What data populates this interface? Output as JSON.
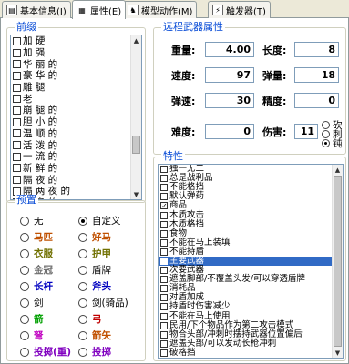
{
  "tabs": [
    {
      "label": "基本信息(I)",
      "icon": "info-icon"
    },
    {
      "label": "属性(E)",
      "icon": "props-icon"
    },
    {
      "label": "模型动作(M)",
      "icon": "model-icon"
    },
    {
      "label": "触发器(T)",
      "icon": "trigger-icon"
    }
  ],
  "prefix": {
    "title": "前缀",
    "items": [
      {
        "label": "加 硬",
        "checked": false
      },
      {
        "label": "加 强",
        "checked": false
      },
      {
        "label": "华 丽 的",
        "checked": false
      },
      {
        "label": "豪 华 的",
        "checked": false
      },
      {
        "label": "雕 腿",
        "checked": false
      },
      {
        "label": "老",
        "checked": false
      },
      {
        "label": "崩 腿 的",
        "checked": false
      },
      {
        "label": "胆 小 的",
        "checked": false
      },
      {
        "label": "温 顺 的",
        "checked": false
      },
      {
        "label": "活 泼 的",
        "checked": false
      },
      {
        "label": "一 流 的",
        "checked": false
      },
      {
        "label": "新 鲜 的",
        "checked": false
      },
      {
        "label": "隔 夜 的",
        "checked": false
      },
      {
        "label": "隔 两 夜 的",
        "checked": false
      },
      {
        "label": "发 臭 的",
        "checked": false
      },
      {
        "label": "腐 烂 的",
        "checked": false
      },
      {
        "label": "一 大 袋",
        "checked": true,
        "selected": true
      }
    ]
  },
  "presets": {
    "title": "预置",
    "items": [
      {
        "label": "无",
        "color": "#000000",
        "checked": false
      },
      {
        "label": "自定义",
        "color": "#000000",
        "checked": true
      },
      {
        "label": "马匹",
        "color": "#c05000",
        "checked": false
      },
      {
        "label": "好马",
        "color": "#c05000",
        "checked": false
      },
      {
        "label": "衣服",
        "color": "#707000",
        "checked": false
      },
      {
        "label": "护甲",
        "color": "#707000",
        "checked": false
      },
      {
        "label": "金冠",
        "color": "#707070",
        "checked": false
      },
      {
        "label": "盾牌",
        "color": "#000000",
        "checked": false
      },
      {
        "label": "长杆",
        "color": "#0000c0",
        "checked": false
      },
      {
        "label": "斧头",
        "color": "#0000c0",
        "checked": false
      },
      {
        "label": "剑",
        "color": "#000000",
        "checked": false
      },
      {
        "label": "剑(骑品)",
        "color": "#000000",
        "checked": false
      },
      {
        "label": "箭",
        "color": "#00a000",
        "checked": false
      },
      {
        "label": "弓",
        "color": "#c00000",
        "checked": false
      },
      {
        "label": "弩",
        "color": "#c000c0",
        "checked": false
      },
      {
        "label": "箭矢",
        "color": "#c05000",
        "checked": false
      },
      {
        "label": "投掷(重)",
        "color": "#8000c0",
        "checked": false
      },
      {
        "label": "投掷",
        "color": "#8000c0",
        "checked": false
      }
    ]
  },
  "weapon": {
    "title": "远程武器属性",
    "weight_label": "重量:",
    "weight": "4.00",
    "length_label": "长度:",
    "length": "8",
    "speed_label": "速度:",
    "speed": "97",
    "ammo_label": "弹量:",
    "ammo": "18",
    "projspeed_label": "弹速:",
    "projspeed": "30",
    "accuracy_label": "精度:",
    "accuracy": "0",
    "difficulty_label": "难度:",
    "difficulty": "0",
    "damage_label": "伤害:",
    "damage": "11",
    "damage_types": [
      {
        "label": "砍",
        "checked": false
      },
      {
        "label": "刺",
        "checked": false
      },
      {
        "label": "钝",
        "checked": true
      }
    ]
  },
  "traits": {
    "title": "特性",
    "items": [
      {
        "label": "独一无二",
        "checked": false
      },
      {
        "label": "总是战利品",
        "checked": false
      },
      {
        "label": "不能格挡",
        "checked": false
      },
      {
        "label": "默认弹药",
        "checked": false
      },
      {
        "label": "商品",
        "checked": true
      },
      {
        "label": "木质攻击",
        "checked": false
      },
      {
        "label": "木质格挡",
        "checked": false
      },
      {
        "label": "食物",
        "checked": false
      },
      {
        "label": "不能在马上装填",
        "checked": false
      },
      {
        "label": "不能持盾",
        "checked": false
      },
      {
        "label": "主要武器",
        "checked": true,
        "selected": true
      },
      {
        "label": "次要武器",
        "checked": false
      },
      {
        "label": "遮盖脚部/不覆盖头发/可以穿透盾牌",
        "checked": false
      },
      {
        "label": "消耗品",
        "checked": false
      },
      {
        "label": "对盾加成",
        "checked": false
      },
      {
        "label": "持盾时伤害减少",
        "checked": false
      },
      {
        "label": "不能在马上使用",
        "checked": false
      },
      {
        "label": "民用/下个物品作为第二攻击模式",
        "checked": false
      },
      {
        "label": "物合头部/冲刺时摆持武器位置偏后",
        "checked": false
      },
      {
        "label": "遮盖头部/可以发动长枪冲刺",
        "checked": false
      },
      {
        "label": "破格挡",
        "checked": false
      }
    ]
  }
}
